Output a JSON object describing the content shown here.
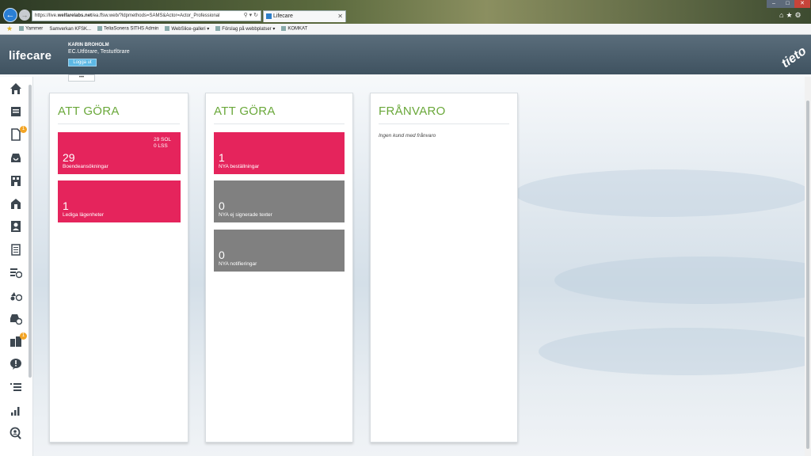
{
  "browser": {
    "address_prefix": "https://live.",
    "address_domain": "welfarelabs.net",
    "address_rest": "/ea.ffsw.web/?ldpmethods=SAMS&Actor=Actor_Professional",
    "tab_title": "Lifecare",
    "favorites": [
      "Yammer",
      "Samverkan KFSK...",
      "TeliaSonera SITHS Admin",
      "WebSlice-galleri ▾",
      "Förslag på webbplatser ▾",
      "KOMKAT"
    ]
  },
  "header": {
    "logo": "lifecare",
    "user_name": "KARIN BROHOLM",
    "user_role": "EC.Utförare, Testutförare",
    "logout_label": "Logga ut",
    "brand": "tieto"
  },
  "more_label": "•••",
  "sidebar": {
    "items": [
      {
        "icon": "home-icon"
      },
      {
        "icon": "book-icon"
      },
      {
        "icon": "document-icon",
        "badge": "1"
      },
      {
        "icon": "inbox-icon"
      },
      {
        "icon": "building-list-icon"
      },
      {
        "icon": "house-icon"
      },
      {
        "icon": "contact-card-icon"
      },
      {
        "icon": "notepad-icon"
      },
      {
        "icon": "list-clock-icon"
      },
      {
        "icon": "transport-clock-icon"
      },
      {
        "icon": "inbox-clock-icon"
      },
      {
        "icon": "building-icon",
        "badge": "1"
      },
      {
        "icon": "alert-bubble-icon"
      },
      {
        "icon": "list-icon"
      },
      {
        "icon": "bar-chart-icon"
      },
      {
        "icon": "search-person-icon"
      }
    ]
  },
  "panels": {
    "todo1": {
      "title": "ATT GÖRA",
      "tiles": [
        {
          "number": "29",
          "label": "Boendeansökningar",
          "extra_1": "29 SOL",
          "extra_2": "0 LSS"
        },
        {
          "number": "1",
          "label": "Lediga lägenheter"
        }
      ]
    },
    "todo2": {
      "title": "ATT GÖRA",
      "tiles": [
        {
          "number": "1",
          "label": "NYA beställningar"
        },
        {
          "number": "0",
          "label": "NYA ej signerade texter"
        },
        {
          "number": "0",
          "label": "NYA notifieringar"
        }
      ]
    },
    "absence": {
      "title": "FRÅNVARO",
      "empty_text": "Ingen kund med frånvaro"
    }
  },
  "colors": {
    "tile_alert": "#e5245c",
    "tile_neutral": "#808080",
    "title_green": "#6aa83a",
    "badge": "#f3a423"
  }
}
